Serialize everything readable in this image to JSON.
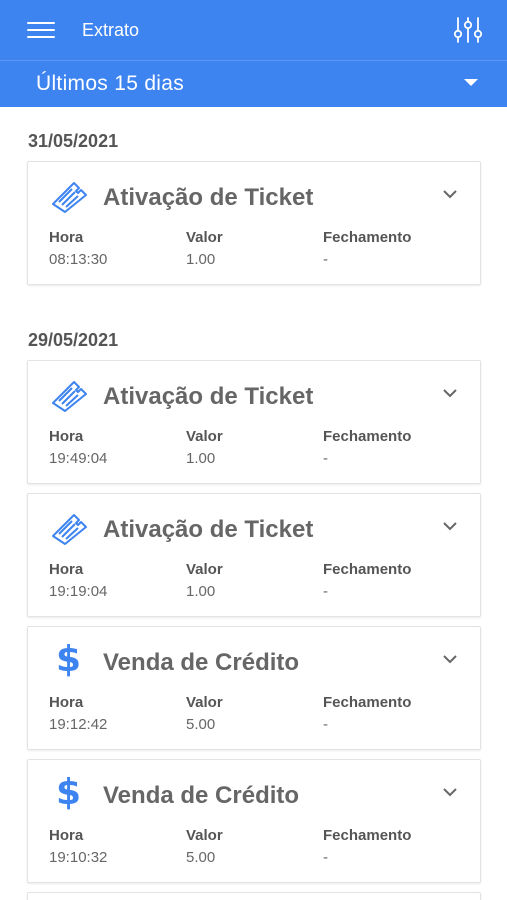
{
  "header": {
    "title": "Extrato",
    "menu_icon": "hamburger-menu-icon",
    "filter_icon": "sliders-filter-icon"
  },
  "period": {
    "label": "Últimos 15 dias"
  },
  "columns": {
    "hora": "Hora",
    "valor": "Valor",
    "fechamento": "Fechamento"
  },
  "groups": [
    {
      "date": "31/05/2021",
      "items": [
        {
          "icon": "ticket-icon",
          "title": "Ativação de Ticket",
          "hora": "08:13:30",
          "valor": "1.00",
          "fechamento": "-"
        }
      ]
    },
    {
      "date": "29/05/2021",
      "items": [
        {
          "icon": "ticket-icon",
          "title": "Ativação de Ticket",
          "hora": "19:49:04",
          "valor": "1.00",
          "fechamento": "-"
        },
        {
          "icon": "ticket-icon",
          "title": "Ativação de Ticket",
          "hora": "19:19:04",
          "valor": "1.00",
          "fechamento": "-"
        },
        {
          "icon": "dollar-icon",
          "title": "Venda de Crédito",
          "hora": "19:12:42",
          "valor": "5.00",
          "fechamento": "-"
        },
        {
          "icon": "dollar-icon",
          "title": "Venda de Crédito",
          "hora": "19:10:32",
          "valor": "5.00",
          "fechamento": "-"
        }
      ]
    }
  ],
  "accent_color": "#3d84f0"
}
